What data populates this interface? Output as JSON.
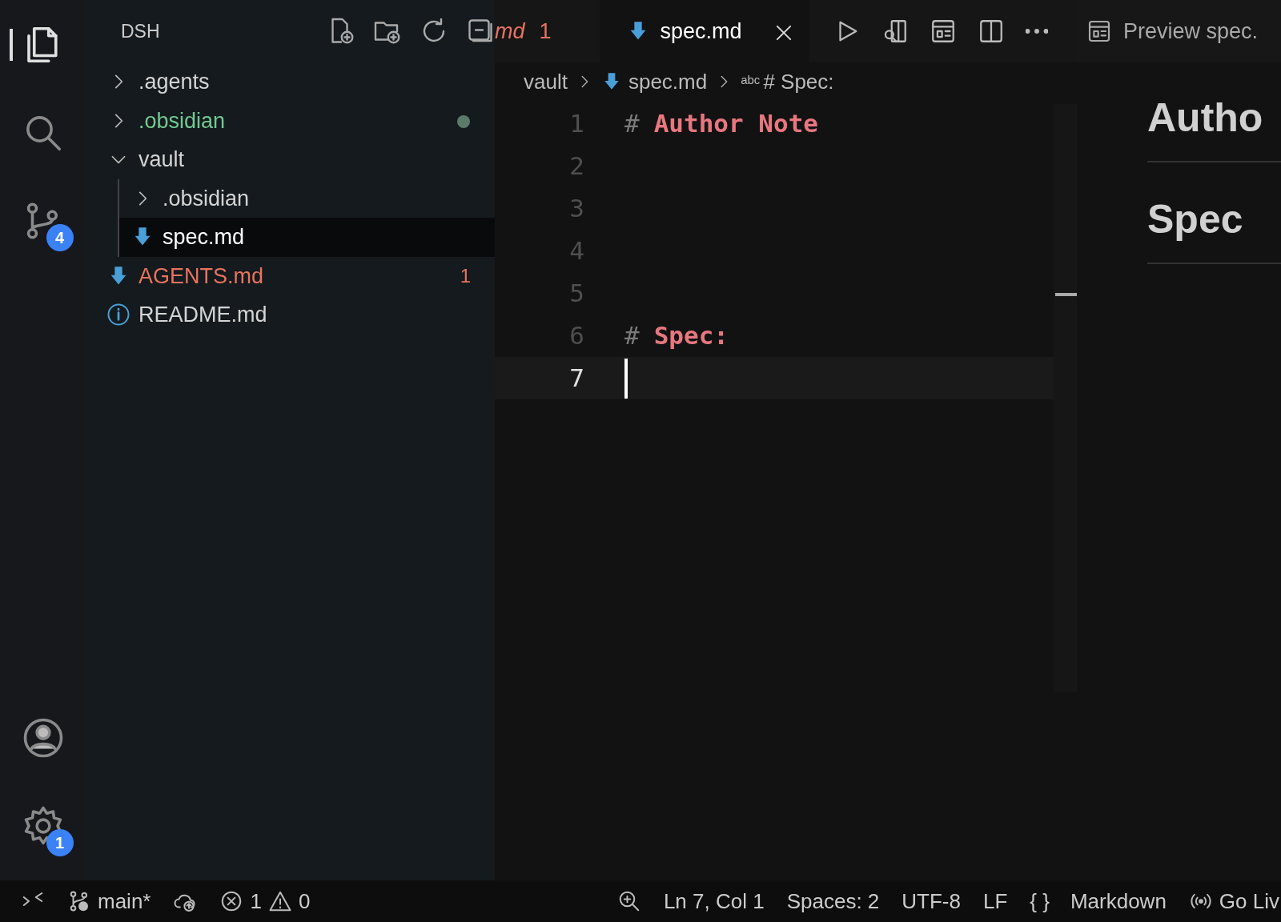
{
  "activity_bar": {
    "items": [
      {
        "kind": "explorer",
        "selected": true
      },
      {
        "kind": "search",
        "selected": false
      },
      {
        "kind": "source-control",
        "selected": false,
        "badge": "4"
      }
    ],
    "bottom_items": [
      {
        "kind": "account"
      },
      {
        "kind": "settings",
        "badge": "1"
      }
    ]
  },
  "sidebar": {
    "title": "DSH",
    "items": [
      {
        "label": ".agents",
        "kind": "folder",
        "expanded": false,
        "color": "#d4d4d4",
        "modified": false,
        "selected": false
      },
      {
        "label": ".obsidian",
        "kind": "folder",
        "expanded": false,
        "color": "#73c991",
        "modified": true,
        "selected": false
      },
      {
        "label": "vault",
        "kind": "folder",
        "expanded": true,
        "color": "#d4d4d4",
        "modified": false,
        "selected": false,
        "children": [
          {
            "label": ".obsidian",
            "kind": "folder",
            "expanded": false,
            "color": "#d4d4d4",
            "modified": false,
            "selected": false
          },
          {
            "label": "spec.md",
            "kind": "markdown",
            "color": "#ffffff",
            "modified": false,
            "selected": true
          }
        ]
      },
      {
        "label": "AGENTS.md",
        "kind": "markdown",
        "color": "#e8735f",
        "modified": false,
        "problems": "1",
        "selected": false
      },
      {
        "label": "README.md",
        "kind": "info",
        "color": "#d4d4d4",
        "modified": false,
        "selected": false
      }
    ]
  },
  "tabs": [
    {
      "label": "md",
      "count": "1",
      "selected": false
    },
    {
      "label": "spec.md",
      "selected": true
    }
  ],
  "breadcrumbs": [
    {
      "label": "vault",
      "kind": "folder"
    },
    {
      "label": "spec.md",
      "kind": "markdown"
    },
    {
      "label": "# Spec:",
      "kind": "symbol",
      "icon_text": "abc"
    }
  ],
  "editor": {
    "lines": [
      {
        "number": "1",
        "kind": "heading",
        "marker": "#",
        "text": "Author Note",
        "current": false
      },
      {
        "number": "2",
        "kind": "empty",
        "current": false
      },
      {
        "number": "3",
        "kind": "empty",
        "current": false
      },
      {
        "number": "4",
        "kind": "empty",
        "current": false
      },
      {
        "number": "5",
        "kind": "empty",
        "current": false
      },
      {
        "number": "6",
        "kind": "heading",
        "marker": "#",
        "text": "Spec:",
        "current": false
      },
      {
        "number": "7",
        "kind": "empty",
        "current": true
      }
    ]
  },
  "preview": {
    "tab": "Preview spec.",
    "headings": [
      "Autho",
      "Spec"
    ]
  },
  "status_bar": {
    "branch": "main*",
    "errors": "1",
    "warnings": "0",
    "position": "Ln 7, Col 1",
    "spaces": "Spaces: 2",
    "encoding": "UTF-8",
    "eol": "LF",
    "braces": "{ }",
    "language": "Markdown",
    "live": "Go Liv"
  }
}
